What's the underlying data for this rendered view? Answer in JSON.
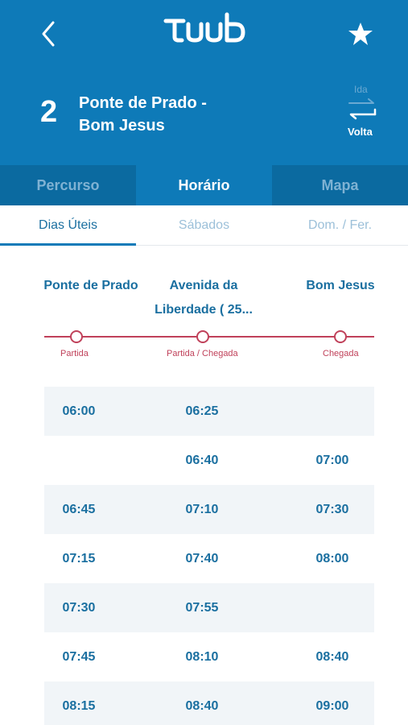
{
  "header": {
    "logo_text": "TUB",
    "route_number": "2",
    "route_name_line1": "Ponte de Prado -",
    "route_name_line2": "Bom Jesus",
    "direction_inactive": "Ida",
    "direction_active": "Volta",
    "bg_color": "#0e7ab8"
  },
  "tabs": [
    {
      "label": "Percurso"
    },
    {
      "label": "Horário"
    },
    {
      "label": "Mapa"
    }
  ],
  "subtabs": [
    {
      "label": "Dias Úteis"
    },
    {
      "label": "Sábados"
    },
    {
      "label": "Dom. / Fer."
    }
  ],
  "stops": {
    "stop1": "Ponte de Prado",
    "stop2_line1": "Avenida da",
    "stop2_line2": "Liberdade ( 25...",
    "stop3": "Bom Jesus"
  },
  "timeline": {
    "label1": "Partida",
    "label2": "Partida / Chegada",
    "label3": "Chegada",
    "color": "#c0415a"
  },
  "schedule": [
    [
      "06:00",
      "06:25",
      ""
    ],
    [
      "",
      "06:40",
      "07:00"
    ],
    [
      "06:45",
      "07:10",
      "07:30"
    ],
    [
      "07:15",
      "07:40",
      "08:00"
    ],
    [
      "07:30",
      "07:55",
      ""
    ],
    [
      "07:45",
      "08:10",
      "08:40"
    ],
    [
      "08:15",
      "08:40",
      "09:00"
    ]
  ]
}
